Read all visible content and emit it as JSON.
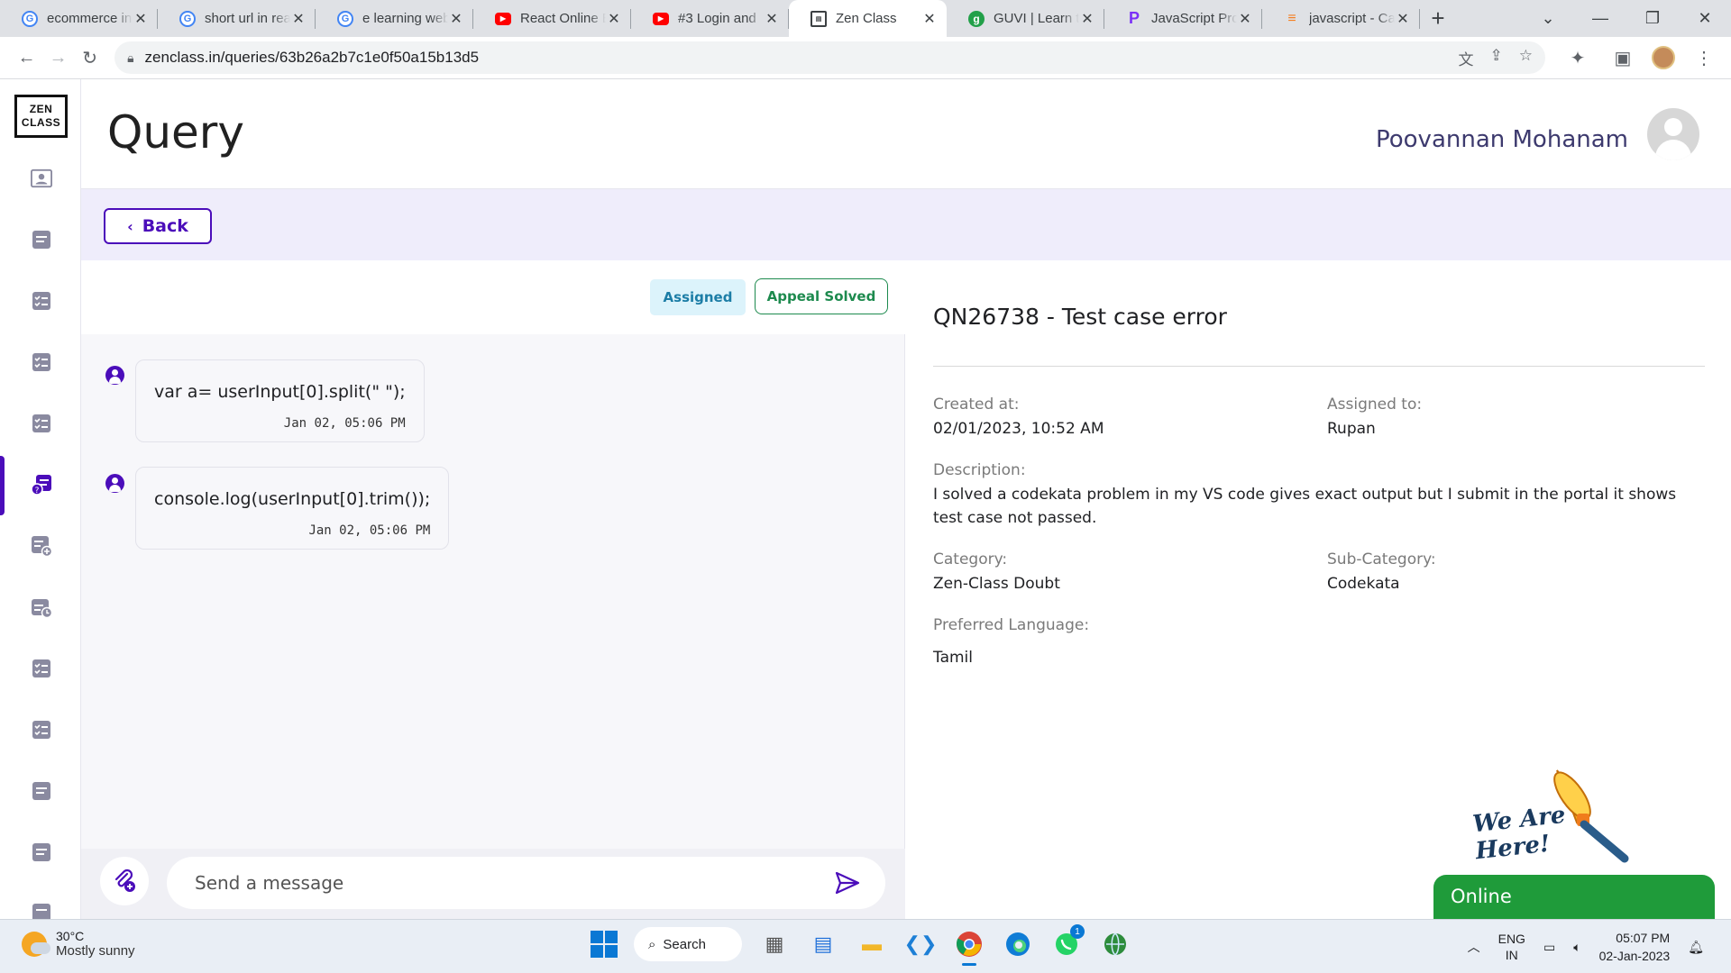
{
  "browser": {
    "tabs": [
      {
        "title": "ecommerce in",
        "icon": "google-icon",
        "active": false
      },
      {
        "title": "short url in rea",
        "icon": "google-icon",
        "active": false
      },
      {
        "title": "e learning web",
        "icon": "google-icon",
        "active": false
      },
      {
        "title": "React Online E",
        "icon": "youtube-icon",
        "active": false
      },
      {
        "title": "#3 Login and",
        "icon": "youtube-icon",
        "active": false
      },
      {
        "title": "Zen Class",
        "icon": "zen-class-icon",
        "active": true
      },
      {
        "title": "GUVI | Learn t",
        "icon": "guvi-icon",
        "active": false
      },
      {
        "title": "JavaScript Pro",
        "icon": "programiz-icon",
        "active": false
      },
      {
        "title": "javascript - Ca",
        "icon": "stackoverflow-icon",
        "active": false
      }
    ],
    "url": "zenclass.in/queries/63b26a2b7c1e0f50a15b13d5"
  },
  "app": {
    "logo_line1": "ZEN",
    "logo_line2": "CLASS",
    "page_title": "Query",
    "user_name": "Poovannan Mohanam",
    "back_label": "Back",
    "accent_color": "#4b0dba"
  },
  "chat": {
    "status_badge": "Assigned",
    "appeal_button": "Appeal Solved",
    "messages": [
      {
        "text": "var a= userInput[0].split(\" \");",
        "time": "Jan 02, 05:06 PM"
      },
      {
        "text": "console.log(userInput[0].trim());",
        "time": "Jan 02, 05:06 PM"
      }
    ],
    "input_placeholder": "Send a message"
  },
  "query": {
    "title": "QN26738 - Test case error",
    "created_label": "Created at:",
    "created_value": "02/01/2023, 10:52 AM",
    "assigned_label": "Assigned to:",
    "assigned_value": "Rupan",
    "description_label": "Description:",
    "description_value": "I solved a codekata problem in my VS code gives exact output but I submit in the portal it shows test case not passed.",
    "category_label": "Category:",
    "category_value": "Zen-Class Doubt",
    "subcategory_label": "Sub-Category:",
    "subcategory_value": "Codekata",
    "language_label": "Preferred Language:",
    "language_value": "Tamil"
  },
  "widget": {
    "promo_line1": "We Are",
    "promo_line2": "Here!",
    "online_label": "Online"
  },
  "taskbar": {
    "temperature": "30°C",
    "weather": "Mostly sunny",
    "search_label": "Search",
    "lang_line1": "ENG",
    "lang_line2": "IN",
    "time": "05:07 PM",
    "date": "02-Jan-2023",
    "notification_count": "1"
  }
}
